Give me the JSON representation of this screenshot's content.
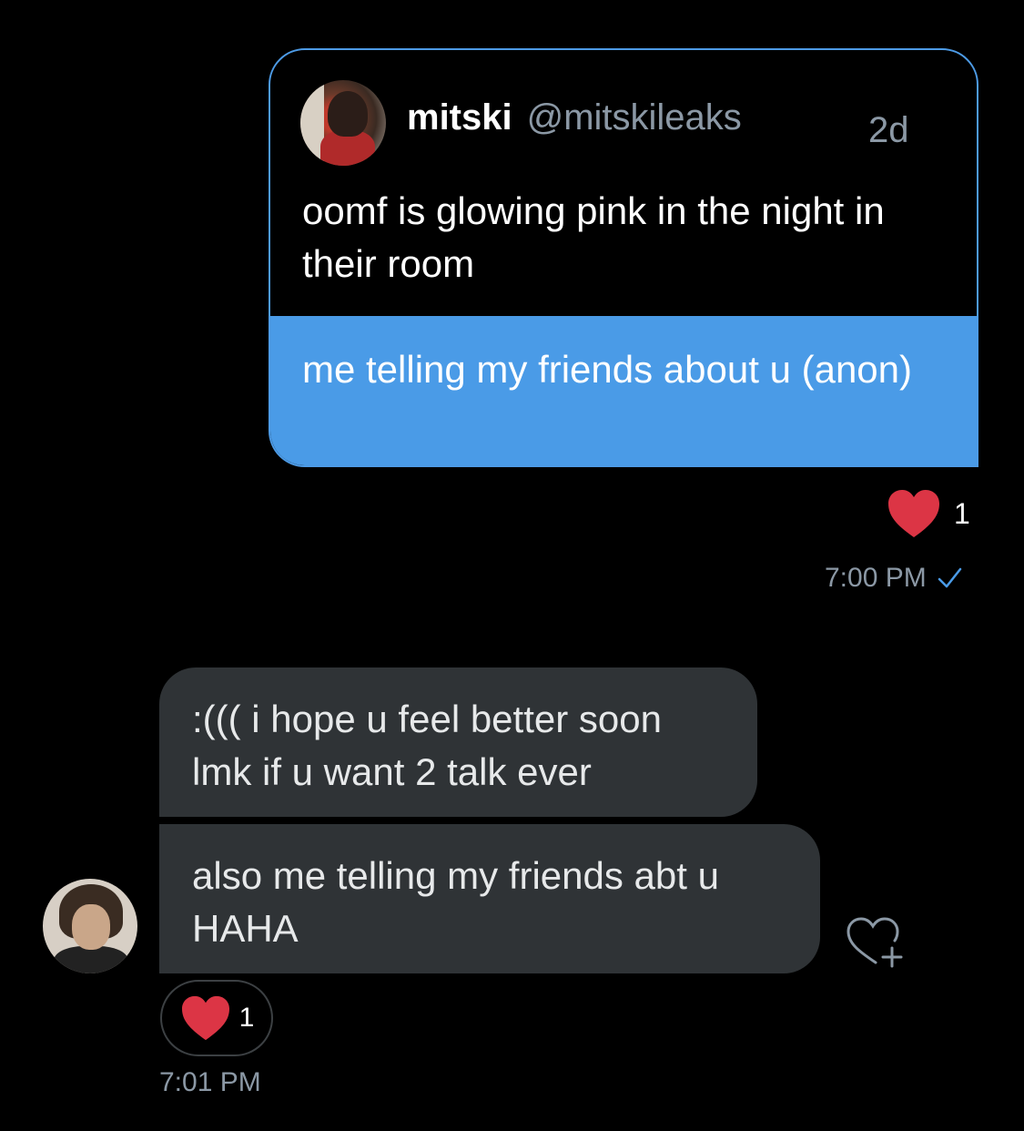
{
  "quoted_tweet": {
    "name": "mitski",
    "handle": "@mitskileaks",
    "time": "2d",
    "text": "oomf is glowing pink in the night in their room"
  },
  "outgoing_message": {
    "text": "me telling my friends about u (anon)",
    "reaction_count": "1",
    "timestamp": "7:00 PM"
  },
  "incoming_messages": [
    {
      "text": ":((( i hope u feel better soon lmk if u want 2 talk ever"
    },
    {
      "text": "also me telling my friends abt u HAHA"
    }
  ],
  "incoming_reaction": {
    "count": "1",
    "timestamp": "7:01 PM"
  },
  "colors": {
    "background": "#000000",
    "outgoing_bubble": "#4a9be7",
    "incoming_bubble": "#2f3336",
    "heart": "#e0245e",
    "muted_text": "#8b98a5"
  },
  "icons": {
    "heart": "heart-icon",
    "read_receipt": "checkmark-icon",
    "add_reaction": "heart-plus-icon"
  }
}
